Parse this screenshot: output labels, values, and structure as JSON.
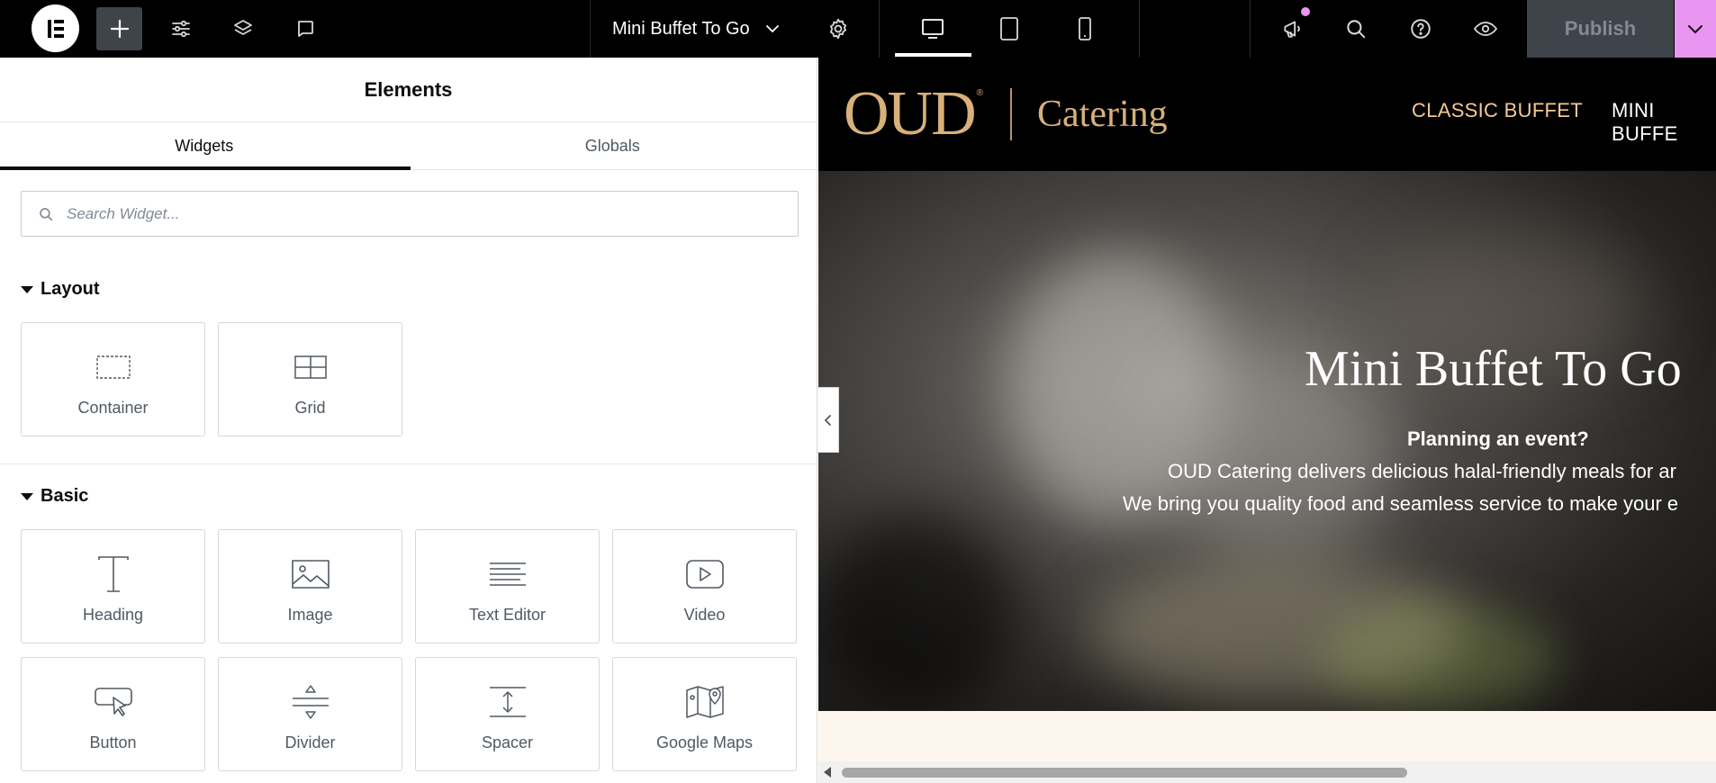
{
  "topbar": {
    "document_title": "Mini Buffet To Go",
    "publish_label": "Publish",
    "icons": [
      "elementor-logo-icon",
      "plus-icon",
      "sliders-icon",
      "layers-icon",
      "comment-icon",
      "chevron-down-icon",
      "gear-icon",
      "desktop-icon",
      "tablet-icon",
      "mobile-icon",
      "megaphone-icon",
      "search-icon",
      "help-icon",
      "eye-icon"
    ],
    "accent_color": "#e896f1"
  },
  "panel": {
    "title": "Elements",
    "tabs": [
      {
        "label": "Widgets",
        "active": true
      },
      {
        "label": "Globals",
        "active": false
      }
    ],
    "search_placeholder": "Search Widget...",
    "sections": [
      {
        "title": "Layout",
        "widgets": [
          {
            "label": "Container",
            "icon": "container-icon"
          },
          {
            "label": "Grid",
            "icon": "grid-icon"
          }
        ]
      },
      {
        "title": "Basic",
        "widgets": [
          {
            "label": "Heading",
            "icon": "heading-icon"
          },
          {
            "label": "Image",
            "icon": "image-icon"
          },
          {
            "label": "Text Editor",
            "icon": "text-editor-icon"
          },
          {
            "label": "Video",
            "icon": "video-icon"
          },
          {
            "label": "Button",
            "icon": "button-icon"
          },
          {
            "label": "Divider",
            "icon": "divider-icon"
          },
          {
            "label": "Spacer",
            "icon": "spacer-icon"
          },
          {
            "label": "Google Maps",
            "icon": "google-maps-icon"
          }
        ]
      }
    ]
  },
  "preview": {
    "logo_text": "OUD",
    "logo_registered": "®",
    "logo_sub": "Catering",
    "nav": [
      {
        "label": "CLASSIC BUFFET",
        "color": "#f5c992"
      },
      {
        "label": "MINI BUFFE",
        "color": "#ffffff"
      }
    ],
    "hero_title": "Mini Buffet To Go",
    "hero_lines": [
      "Planning an event?",
      "OUD Catering delivers delicious halal-friendly meals for ar",
      "We bring you quality food and seamless service to make your e"
    ]
  }
}
